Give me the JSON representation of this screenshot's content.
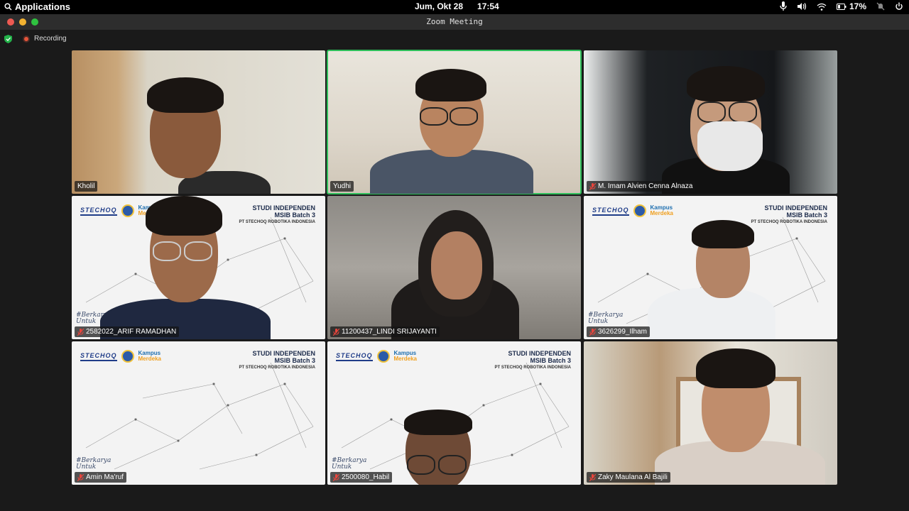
{
  "system_bar": {
    "applications_label": "Applications",
    "date": "Jum, Okt 28",
    "time": "17:54",
    "battery": "17%"
  },
  "window": {
    "title": "Zoom Meeting"
  },
  "meeting": {
    "recording_label": "Recording"
  },
  "virtual_background": {
    "brand": "STECHOQ",
    "kampus_line1": "Kampus",
    "kampus_line2": "Merdeka",
    "heading_line1": "STUDI INDEPENDEN",
    "heading_line2": "MSIB Batch 3",
    "heading_line3": "PT STECHOQ ROBOTIKA INDONESIA",
    "tagline_line1": "#Berkarya",
    "tagline_line2": "Untuk"
  },
  "participants": [
    {
      "name": "Kholil",
      "muted": false
    },
    {
      "name": "Yudhi",
      "muted": false
    },
    {
      "name": "M. Imam Alvien Cenna Alnaza",
      "muted": true
    },
    {
      "name": "2582022_ARIF RAMADHAN",
      "muted": true
    },
    {
      "name": "11200437_LINDI SRIJAYANTI",
      "muted": true
    },
    {
      "name": "3626299_Ilham",
      "muted": true
    },
    {
      "name": "Amin Ma'ruf",
      "muted": true
    },
    {
      "name": "2500080_Habil",
      "muted": true
    },
    {
      "name": "Zaky Maulana Al Bajili",
      "muted": true
    }
  ],
  "colors": {
    "active_speaker": "#2fbf5b",
    "mute_icon": "#e8453c"
  }
}
